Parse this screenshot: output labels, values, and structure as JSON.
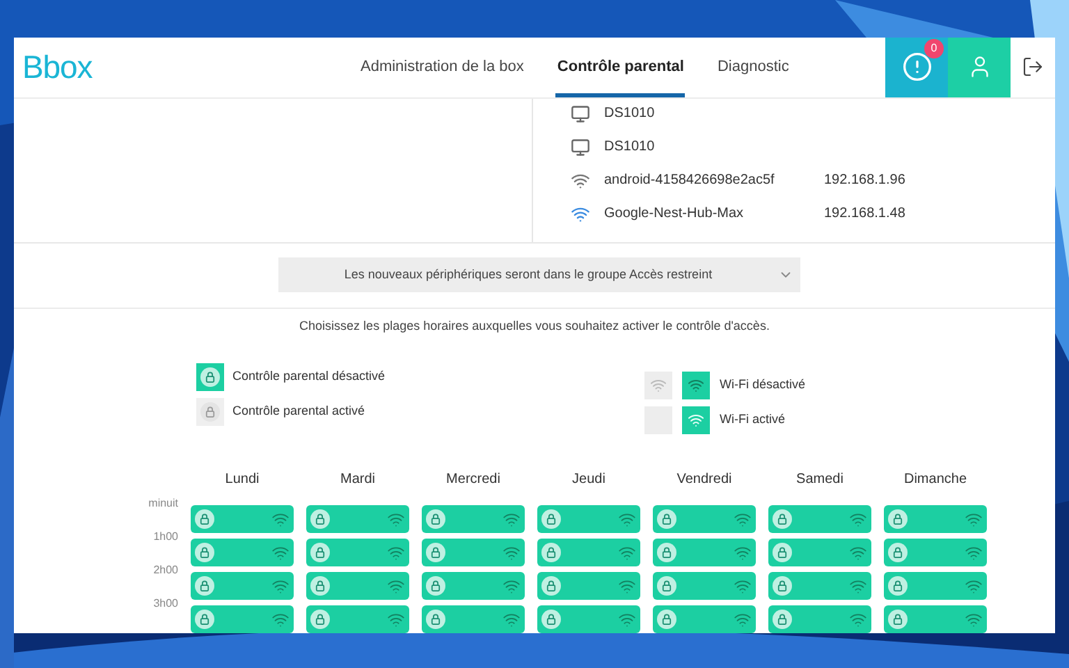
{
  "header": {
    "logo": "Bbox",
    "nav": [
      {
        "label": "Administration de la box",
        "selected": false
      },
      {
        "label": "Contrôle parental",
        "selected": true
      },
      {
        "label": "Diagnostic",
        "selected": false
      }
    ],
    "alerts_badge": "0"
  },
  "devices": [
    {
      "kind": "wired",
      "name": "DS1010",
      "online": false
    },
    {
      "kind": "wired",
      "name": "DS1010",
      "online": false
    },
    {
      "kind": "wifi",
      "name": "android-4158426698e2ac5f",
      "ip": "192.168.1.96",
      "online": false
    },
    {
      "kind": "wifi",
      "name": "Google-Nest-Hub-Max",
      "ip": "192.168.1.48",
      "online": true
    }
  ],
  "group_select": {
    "value": "Les nouveaux périphériques seront dans le groupe Accès restreint"
  },
  "instruction": "Choisissez les plages horaires auxquelles vous souhaitez activer le contrôle d'accès.",
  "legend": {
    "parental": [
      {
        "label": "Contrôle parental désactivé",
        "parental_control": false
      },
      {
        "label": "Contrôle parental activé",
        "parental_control": true
      }
    ],
    "wifi": [
      {
        "label": "Wi-Fi désactivé",
        "wifi": false
      },
      {
        "label": "Wi-Fi activé",
        "wifi": true
      }
    ]
  },
  "schedule": {
    "days": [
      "Lundi",
      "Mardi",
      "Mercredi",
      "Jeudi",
      "Vendredi",
      "Samedi",
      "Dimanche"
    ],
    "rows": [
      {
        "label": "minuit",
        "cells": [
          {
            "parental_control": false,
            "wifi": false
          },
          {
            "parental_control": false,
            "wifi": false
          },
          {
            "parental_control": false,
            "wifi": false
          },
          {
            "parental_control": false,
            "wifi": false
          },
          {
            "parental_control": false,
            "wifi": false
          },
          {
            "parental_control": false,
            "wifi": false
          },
          {
            "parental_control": false,
            "wifi": false
          }
        ]
      },
      {
        "label": "1h00",
        "cells": [
          {
            "parental_control": false,
            "wifi": false
          },
          {
            "parental_control": false,
            "wifi": false
          },
          {
            "parental_control": false,
            "wifi": false
          },
          {
            "parental_control": false,
            "wifi": false
          },
          {
            "parental_control": false,
            "wifi": false
          },
          {
            "parental_control": false,
            "wifi": false
          },
          {
            "parental_control": false,
            "wifi": false
          }
        ]
      },
      {
        "label": "2h00",
        "cells": [
          {
            "parental_control": false,
            "wifi": false
          },
          {
            "parental_control": false,
            "wifi": false
          },
          {
            "parental_control": false,
            "wifi": false
          },
          {
            "parental_control": false,
            "wifi": false
          },
          {
            "parental_control": false,
            "wifi": false
          },
          {
            "parental_control": false,
            "wifi": false
          },
          {
            "parental_control": false,
            "wifi": false
          }
        ]
      },
      {
        "label": "3h00",
        "cells": [
          {
            "parental_control": false,
            "wifi": false
          },
          {
            "parental_control": false,
            "wifi": false
          },
          {
            "parental_control": false,
            "wifi": false
          },
          {
            "parental_control": false,
            "wifi": false
          },
          {
            "parental_control": false,
            "wifi": false
          },
          {
            "parental_control": false,
            "wifi": false
          },
          {
            "parental_control": false,
            "wifi": false
          }
        ]
      }
    ]
  }
}
